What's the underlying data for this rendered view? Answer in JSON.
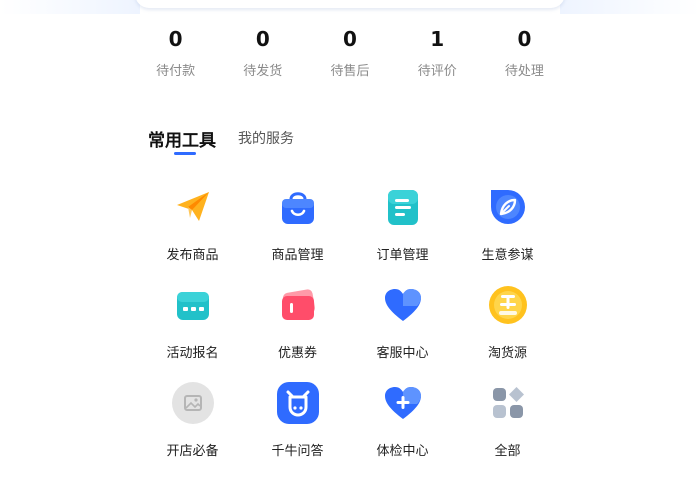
{
  "orders": [
    {
      "count": "0",
      "label": "待付款"
    },
    {
      "count": "0",
      "label": "待发货"
    },
    {
      "count": "0",
      "label": "待售后"
    },
    {
      "count": "1",
      "label": "待评价"
    },
    {
      "count": "0",
      "label": "待处理"
    }
  ],
  "tabs": {
    "common_tools": "常用工具",
    "my_services": "我的服务"
  },
  "tools": [
    {
      "label": "发布商品",
      "icon": "paper-plane-icon"
    },
    {
      "label": "商品管理",
      "icon": "shopping-bag-icon"
    },
    {
      "label": "订单管理",
      "icon": "document-list-icon"
    },
    {
      "label": "生意参谋",
      "icon": "compass-leaf-icon"
    },
    {
      "label": "活动报名",
      "icon": "calendar-icon"
    },
    {
      "label": "优惠券",
      "icon": "coupon-ticket-icon"
    },
    {
      "label": "客服中心",
      "icon": "heart-icon"
    },
    {
      "label": "淘货源",
      "icon": "goods-source-badge-icon"
    },
    {
      "label": "开店必备",
      "icon": "image-placeholder-icon"
    },
    {
      "label": "千牛问答",
      "icon": "cow-head-icon"
    },
    {
      "label": "体检中心",
      "icon": "heart-plus-icon"
    },
    {
      "label": "全部",
      "icon": "apps-grid-icon"
    }
  ],
  "colors": {
    "accent": "#2f6bff",
    "orange": "#ffb21e",
    "teal": "#21c1c9",
    "red": "#ff4d6a"
  }
}
